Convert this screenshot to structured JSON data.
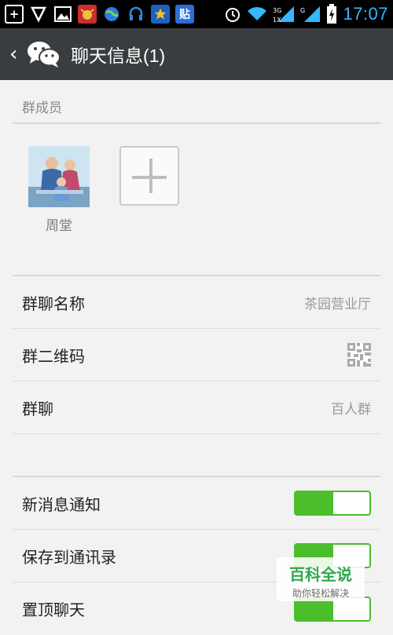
{
  "status_bar": {
    "time": "17:07",
    "icons": [
      "plus-square-icon",
      "shield-icon",
      "image-icon",
      "ox-icon",
      "globe-icon",
      "headset-icon",
      "star-icon",
      "tieba-icon",
      "alarm-icon",
      "wifi-icon",
      "signal-3g-icon",
      "signal-icon",
      "battery-icon"
    ],
    "tieba_glyph": "贴"
  },
  "header": {
    "title": "聊天信息(1)",
    "back_glyph": "‹"
  },
  "members_section": {
    "label": "群成员",
    "members": [
      {
        "name": "周堂"
      }
    ]
  },
  "info_rows": [
    {
      "label": "群聊名称",
      "value": "茶园营业厅"
    },
    {
      "label": "群二维码",
      "value": ""
    },
    {
      "label": "群聊",
      "value": "百人群"
    }
  ],
  "toggle_rows": [
    {
      "label": "新消息通知",
      "on": true
    },
    {
      "label": "保存到通讯录",
      "on": true
    },
    {
      "label": "置顶聊天",
      "on": true
    }
  ],
  "watermark": {
    "title": "百科全说",
    "subtitle": "助你轻松解决"
  },
  "colors": {
    "toggle_green": "#4cbd2b",
    "titlebar": "#3a3d3f",
    "time_blue": "#35b8ff"
  }
}
